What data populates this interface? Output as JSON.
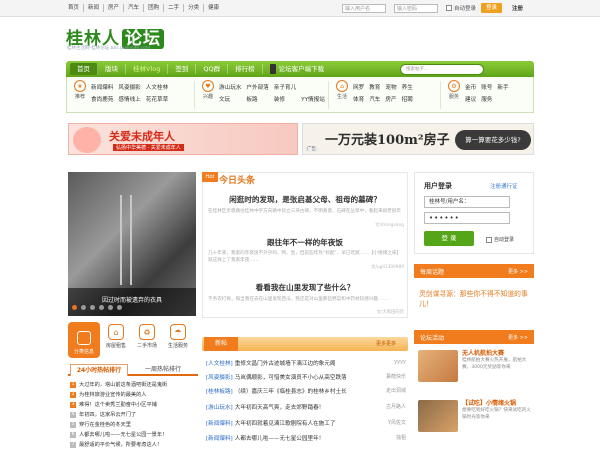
{
  "topbar": {
    "links": [
      "首页",
      "新闻",
      "房产",
      "汽车",
      "团购",
      "二手",
      "分类",
      "健康"
    ],
    "username_placeholder": "输入用户名",
    "password_placeholder": "输入密码",
    "auto_login": "自动登录",
    "login": "登录",
    "register": "注册"
  },
  "logo": {
    "name_a": "桂林人",
    "name_b": "论坛",
    "sub": "桂林生活网-桂林论坛 bbs.guilinlife.com"
  },
  "nav": {
    "items": [
      "首页",
      "版块",
      "桂林Vlog",
      "签到",
      "QQ群",
      "排行榜"
    ],
    "app": "论坛客户端下载",
    "search_placeholder": "搜索帖子..."
  },
  "categories": [
    {
      "icon": "推荐",
      "links": [
        "新闻爆料",
        "风姿摄影",
        "人文桂林",
        "食尚鹿苑",
        "感情线上",
        "花花草草"
      ]
    },
    {
      "icon": "兴趣",
      "links": [
        "游山玩水",
        "户外部落",
        "亲子育儿",
        "文玩",
        "板路",
        "装修",
        "YY情报站"
      ]
    },
    {
      "icon": "生活",
      "links": [
        "网罗",
        "教育",
        "宠物",
        "养生",
        "体育",
        "汽车",
        "房产",
        "招聘"
      ]
    },
    {
      "icon": "服务",
      "links": [
        "金币",
        "账号",
        "新手",
        "建议",
        "服务"
      ]
    }
  ],
  "banner1": {
    "title": "关爱未成年人",
    "sub": "弘扬中华美德 · 关爱未成年人"
  },
  "banner2": {
    "title": "一万元装100m²房子",
    "question": "算一算要花多少钱?",
    "ad": "广告"
  },
  "photo": {
    "caption": "因过时而被遗弃的衣具"
  },
  "quick": [
    "分类信息",
    "房屋租售",
    "二手市场",
    "生活服务"
  ],
  "hot": {
    "tab1": "24小时热帖排行",
    "tab2": "一周热帖排行",
    "rows": [
      "大过年的，塔山前这条酒吧街还是鬼街",
      "为桂林旅游业宣传的最美的人",
      "难得！这个卖秀兰勤奋中小区平铺",
      "年初四，这家吊云开门了",
      "穿行在金桂色的冬天里",
      "人都去哪儿啦——无七星公园一景年！",
      "最舒适的平价气候，所要考虑这人！"
    ]
  },
  "headlines": {
    "badge": "Hot",
    "title": "今日头条",
    "items": [
      {
        "title": "闲逛时的发现，是张启基父母、祖母的墓碑？",
        "summary": "在桂林区步骤路往桂林中学方向路中段立三块古碑，不明真意，石碑在丛草中，看起来很老很年",
        "source": "文/drongvang"
      },
      {
        "title": "跟往年不一样的年夜饭",
        "summary": "几十年来，我家的年夜饭不外乎鸡、鸭、鱼，但前些年热“标配”，早已吃腻……【小情绪之味】就这样上了我家年夜……",
        "source": "文/ugli1300989"
      },
      {
        "title": "看看我在山里发现了些什么？",
        "summary": "不务农打探，每当我在去在山里发现西瓜，我还是对山里那些野菜和中药材较感兴趣……",
        "source": "文/大和田的后"
      }
    ]
  },
  "latest": {
    "tab": "新帖",
    "more": "更多更多",
    "rows": [
      {
        "tag": "[人文桂林]",
        "title": "重修文昌门外古迹城墙下漓江边的象元阁",
        "author": "yyyy"
      },
      {
        "tag": "[风姿摄影]",
        "title": "马岚偶顺影，可惜美女演员不小心从高空跌落",
        "author": "蒹葭快乐"
      },
      {
        "tag": "[桂林板路]",
        "title": "（续）嘉庆三年《临桂县志》的桂林乡村土长",
        "author": "走出洞城"
      },
      {
        "tag": "[游山玩水]",
        "title": "大年初四天高气爽，走去郊野踏春！",
        "author": "古月路人"
      },
      {
        "tag": "[新闻爆料]",
        "title": "大年初四就着见漓江歌剧院有人在施工了",
        "author": "Y风佐文"
      },
      {
        "tag": "[新闻爆料]",
        "title": "人都去哪儿啦——无七星公园里年！",
        "author": "独祖"
      }
    ]
  },
  "login": {
    "title": "用户登录",
    "register": "注册通行证",
    "username_value": "桂林号/用户名：",
    "password_value": "••••••",
    "button": "登 录",
    "auto": "自动登录"
  },
  "daily": {
    "title": "每周话题",
    "more": "更多 >>",
    "text": "灵剑谋寻源：那些你不得不知道的事儿！"
  },
  "activity": {
    "title": "论坛活动",
    "more": "更多 >>",
    "items": [
      {
        "title": "无人机航拍大赛",
        "desc": "桂林航拍大赛火热开展，航拍大赛，3000元奖励等你来"
      },
      {
        "title": "【试吃】小情绪火锅",
        "desc": "想要吃到好吃火锅？快来试吃的火锅时光等你来"
      }
    ]
  }
}
